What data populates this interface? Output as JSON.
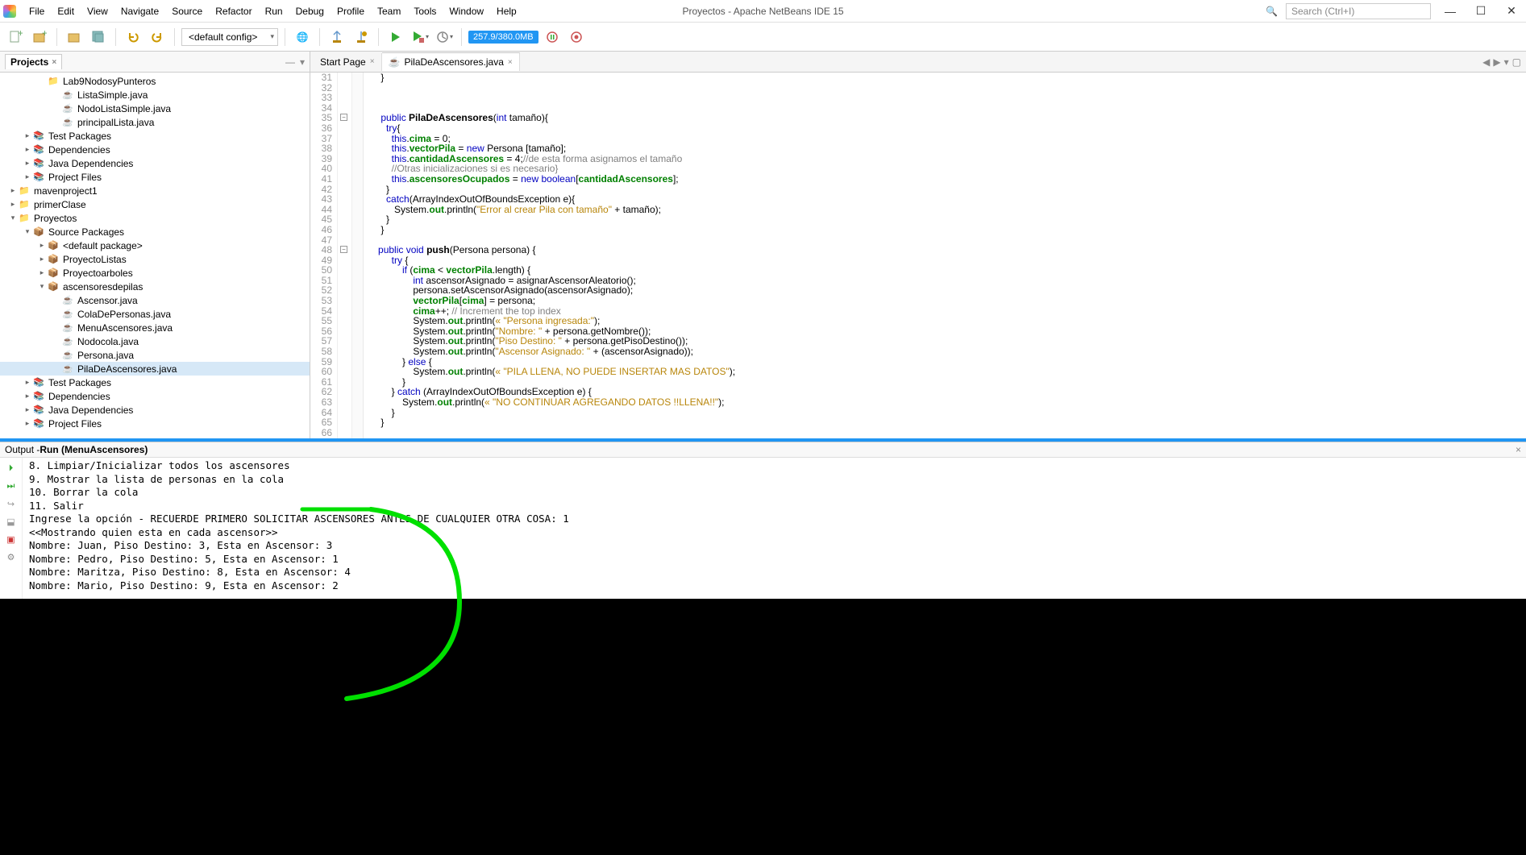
{
  "window": {
    "title": "Proyectos - Apache NetBeans IDE 15",
    "search_placeholder": "Search (Ctrl+I)"
  },
  "menus": [
    "File",
    "Edit",
    "View",
    "Navigate",
    "Source",
    "Refactor",
    "Run",
    "Debug",
    "Profile",
    "Team",
    "Tools",
    "Window",
    "Help"
  ],
  "toolbar": {
    "config": "<default config>",
    "memory": "257.9/380.0MB"
  },
  "projects_panel": {
    "title": "Projects"
  },
  "tree": [
    {
      "d": 2,
      "t": "folder",
      "exp": true,
      "label": "Lab9NodosyPunteros"
    },
    {
      "d": 3,
      "t": "java",
      "label": "ListaSimple.java"
    },
    {
      "d": 3,
      "t": "java",
      "label": "NodoListaSimple.java"
    },
    {
      "d": 3,
      "t": "java",
      "label": "principalLista.java"
    },
    {
      "d": 1,
      "t": "dep",
      "tg": ">",
      "label": "Test Packages"
    },
    {
      "d": 1,
      "t": "dep",
      "tg": ">",
      "label": "Dependencies"
    },
    {
      "d": 1,
      "t": "dep",
      "tg": ">",
      "label": "Java Dependencies"
    },
    {
      "d": 1,
      "t": "dep",
      "tg": ">",
      "label": "Project Files"
    },
    {
      "d": 0,
      "t": "proj",
      "tg": ">",
      "label": "mavenproject1"
    },
    {
      "d": 0,
      "t": "proj",
      "tg": ">",
      "label": "primerClase"
    },
    {
      "d": 0,
      "t": "proj",
      "tg": "v",
      "label": "Proyectos"
    },
    {
      "d": 1,
      "t": "pkg",
      "tg": "v",
      "label": "Source Packages"
    },
    {
      "d": 2,
      "t": "pkg",
      "tg": ">",
      "label": "<default package>"
    },
    {
      "d": 2,
      "t": "pkg",
      "tg": ">",
      "label": "ProyectoListas"
    },
    {
      "d": 2,
      "t": "pkg",
      "tg": ">",
      "label": "Proyectoarboles"
    },
    {
      "d": 2,
      "t": "pkg",
      "tg": "v",
      "label": "ascensoresdepilas"
    },
    {
      "d": 3,
      "t": "java",
      "label": "Ascensor.java"
    },
    {
      "d": 3,
      "t": "java",
      "label": "ColaDePersonas.java"
    },
    {
      "d": 3,
      "t": "java",
      "label": "MenuAscensores.java"
    },
    {
      "d": 3,
      "t": "java",
      "label": "Nodocola.java"
    },
    {
      "d": 3,
      "t": "java",
      "label": "Persona.java"
    },
    {
      "d": 3,
      "t": "java",
      "label": "PilaDeAscensores.java",
      "sel": true
    },
    {
      "d": 1,
      "t": "dep",
      "tg": ">",
      "label": "Test Packages"
    },
    {
      "d": 1,
      "t": "dep",
      "tg": ">",
      "label": "Dependencies"
    },
    {
      "d": 1,
      "t": "dep",
      "tg": ">",
      "label": "Java Dependencies"
    },
    {
      "d": 1,
      "t": "dep",
      "tg": ">",
      "label": "Project Files"
    }
  ],
  "editor": {
    "tabs": [
      {
        "label": "Start Page",
        "active": false
      },
      {
        "label": "PilaDeAscensores.java",
        "active": true,
        "icon": "java"
      }
    ],
    "first_line": 31,
    "code_html": "    }\n\n\n\n    <span class='kw'>public</span> <b>PilaDeAscensores</b>(<span class='kw'>int</span> tamaño){\n      <span class='kw'>try</span>{\n        <span class='kw'>this</span>.<span class='fld'>cima</span> = <span class='num'>0</span>;\n        <span class='kw'>this</span>.<span class='fld'>vectorPila</span> = <span class='kw'>new</span> Persona [tamaño];\n        <span class='kw'>this</span>.<span class='fld'>cantidadAscensores</span> = <span class='num'>4</span>;<span class='cmt'>//de esta forma asignamos el tamaño</span>\n        <span class='cmt'>//Otras inicializaciones si es necesario}</span>\n        <span class='kw'>this</span>.<span class='fld'>ascensoresOcupados</span> = <span class='kw'>new</span> <span class='kw'>boolean</span>[<span class='fld'>cantidadAscensores</span>];\n      }\n      <span class='kw'>catch</span>(ArrayIndexOutOfBoundsException e){\n         System.<span class='fld'>out</span>.println(<span class='str'>\"Error al crear Pila con tamaño\"</span> + tamaño);\n      }\n    }\n\n   <span class='kw'>public void</span> <b>push</b>(Persona persona) {\n        <span class='kw'>try</span> {\n            <span class='kw'>if</span> (<span class='fld'>cima</span> &lt; <span class='fld'>vectorPila</span>.length) {\n                <span class='kw'>int</span> ascensorAsignado = asignarAscensorAleatorio();\n                persona.setAscensorAsignado(ascensorAsignado);\n                <span class='fld'>vectorPila</span>[<span class='fld'>cima</span>] = persona;\n                <span class='fld'>cima</span>++; <span class='cmt'>// Increment the top index</span>\n                System.<span class='fld'>out</span>.println(<span class='str'>« \"Persona ingresada:\"</span>);\n                System.<span class='fld'>out</span>.println(<span class='str'>\"Nombre: \"</span> + persona.getNombre());\n                System.<span class='fld'>out</span>.println(<span class='str'>\"Piso Destino: \"</span> + persona.getPisoDestino());\n                System.<span class='fld'>out</span>.println(<span class='str'>\"Ascensor Asignado: \"</span> + (ascensorAsignado));\n            } <span class='kw'>else</span> {\n                System.<span class='fld'>out</span>.println(<span class='str'>« \"PILA LLENA, NO PUEDE INSERTAR MAS DATOS\"</span>);\n            }\n        } <span class='kw'>catch</span> (ArrayIndexOutOfBoundsException e) {\n            System.<span class='fld'>out</span>.println(<span class='str'>« \"NO CONTINUAR AGREGANDO DATOS !!LLENA!!\"</span>);\n        }\n    }\n\n   <span class='kw'>private int</span> <b>asignarAscensorAleatorio</b>() {"
  },
  "output": {
    "title_prefix": "Output - ",
    "title_bold": "Run (MenuAscensores)",
    "lines": [
      "8. Limpiar/Inicializar todos los ascensores",
      "9. Mostrar la lista de personas en la cola",
      "10. Borrar la cola",
      "11. Salir",
      "Ingrese la opción - RECUERDE PRIMERO SOLICITAR ASCENSORES ANTES DE CUALQUIER OTRA COSA: 1",
      "<<Mostrando quien esta en cada ascensor>>",
      "Nombre: Juan, Piso Destino: 3, Esta en Ascensor: 3",
      "Nombre: Pedro, Piso Destino: 5, Esta en Ascensor: 1",
      "Nombre: Maritza, Piso Destino: 8, Esta en Ascensor: 4",
      "Nombre: Mario, Piso Destino: 9, Esta en Ascensor: 2"
    ]
  }
}
